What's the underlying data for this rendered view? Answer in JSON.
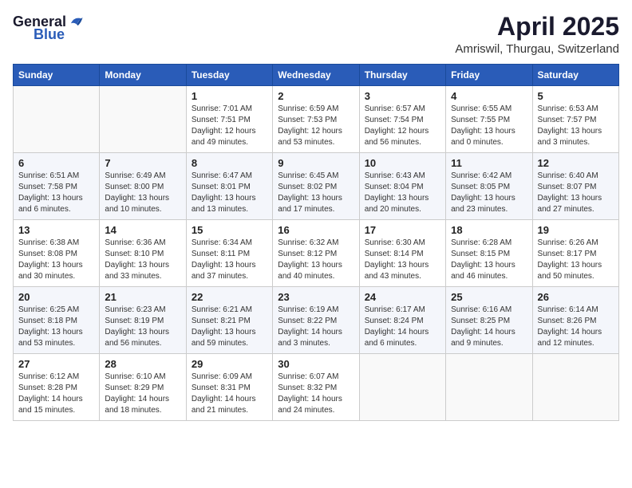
{
  "logo": {
    "general": "General",
    "blue": "Blue"
  },
  "title": "April 2025",
  "location": "Amriswil, Thurgau, Switzerland",
  "columns": [
    "Sunday",
    "Monday",
    "Tuesday",
    "Wednesday",
    "Thursday",
    "Friday",
    "Saturday"
  ],
  "weeks": [
    [
      {
        "day": "",
        "info": ""
      },
      {
        "day": "",
        "info": ""
      },
      {
        "day": "1",
        "info": "Sunrise: 7:01 AM\nSunset: 7:51 PM\nDaylight: 12 hours and 49 minutes."
      },
      {
        "day": "2",
        "info": "Sunrise: 6:59 AM\nSunset: 7:53 PM\nDaylight: 12 hours and 53 minutes."
      },
      {
        "day": "3",
        "info": "Sunrise: 6:57 AM\nSunset: 7:54 PM\nDaylight: 12 hours and 56 minutes."
      },
      {
        "day": "4",
        "info": "Sunrise: 6:55 AM\nSunset: 7:55 PM\nDaylight: 13 hours and 0 minutes."
      },
      {
        "day": "5",
        "info": "Sunrise: 6:53 AM\nSunset: 7:57 PM\nDaylight: 13 hours and 3 minutes."
      }
    ],
    [
      {
        "day": "6",
        "info": "Sunrise: 6:51 AM\nSunset: 7:58 PM\nDaylight: 13 hours and 6 minutes."
      },
      {
        "day": "7",
        "info": "Sunrise: 6:49 AM\nSunset: 8:00 PM\nDaylight: 13 hours and 10 minutes."
      },
      {
        "day": "8",
        "info": "Sunrise: 6:47 AM\nSunset: 8:01 PM\nDaylight: 13 hours and 13 minutes."
      },
      {
        "day": "9",
        "info": "Sunrise: 6:45 AM\nSunset: 8:02 PM\nDaylight: 13 hours and 17 minutes."
      },
      {
        "day": "10",
        "info": "Sunrise: 6:43 AM\nSunset: 8:04 PM\nDaylight: 13 hours and 20 minutes."
      },
      {
        "day": "11",
        "info": "Sunrise: 6:42 AM\nSunset: 8:05 PM\nDaylight: 13 hours and 23 minutes."
      },
      {
        "day": "12",
        "info": "Sunrise: 6:40 AM\nSunset: 8:07 PM\nDaylight: 13 hours and 27 minutes."
      }
    ],
    [
      {
        "day": "13",
        "info": "Sunrise: 6:38 AM\nSunset: 8:08 PM\nDaylight: 13 hours and 30 minutes."
      },
      {
        "day": "14",
        "info": "Sunrise: 6:36 AM\nSunset: 8:10 PM\nDaylight: 13 hours and 33 minutes."
      },
      {
        "day": "15",
        "info": "Sunrise: 6:34 AM\nSunset: 8:11 PM\nDaylight: 13 hours and 37 minutes."
      },
      {
        "day": "16",
        "info": "Sunrise: 6:32 AM\nSunset: 8:12 PM\nDaylight: 13 hours and 40 minutes."
      },
      {
        "day": "17",
        "info": "Sunrise: 6:30 AM\nSunset: 8:14 PM\nDaylight: 13 hours and 43 minutes."
      },
      {
        "day": "18",
        "info": "Sunrise: 6:28 AM\nSunset: 8:15 PM\nDaylight: 13 hours and 46 minutes."
      },
      {
        "day": "19",
        "info": "Sunrise: 6:26 AM\nSunset: 8:17 PM\nDaylight: 13 hours and 50 minutes."
      }
    ],
    [
      {
        "day": "20",
        "info": "Sunrise: 6:25 AM\nSunset: 8:18 PM\nDaylight: 13 hours and 53 minutes."
      },
      {
        "day": "21",
        "info": "Sunrise: 6:23 AM\nSunset: 8:19 PM\nDaylight: 13 hours and 56 minutes."
      },
      {
        "day": "22",
        "info": "Sunrise: 6:21 AM\nSunset: 8:21 PM\nDaylight: 13 hours and 59 minutes."
      },
      {
        "day": "23",
        "info": "Sunrise: 6:19 AM\nSunset: 8:22 PM\nDaylight: 14 hours and 3 minutes."
      },
      {
        "day": "24",
        "info": "Sunrise: 6:17 AM\nSunset: 8:24 PM\nDaylight: 14 hours and 6 minutes."
      },
      {
        "day": "25",
        "info": "Sunrise: 6:16 AM\nSunset: 8:25 PM\nDaylight: 14 hours and 9 minutes."
      },
      {
        "day": "26",
        "info": "Sunrise: 6:14 AM\nSunset: 8:26 PM\nDaylight: 14 hours and 12 minutes."
      }
    ],
    [
      {
        "day": "27",
        "info": "Sunrise: 6:12 AM\nSunset: 8:28 PM\nDaylight: 14 hours and 15 minutes."
      },
      {
        "day": "28",
        "info": "Sunrise: 6:10 AM\nSunset: 8:29 PM\nDaylight: 14 hours and 18 minutes."
      },
      {
        "day": "29",
        "info": "Sunrise: 6:09 AM\nSunset: 8:31 PM\nDaylight: 14 hours and 21 minutes."
      },
      {
        "day": "30",
        "info": "Sunrise: 6:07 AM\nSunset: 8:32 PM\nDaylight: 14 hours and 24 minutes."
      },
      {
        "day": "",
        "info": ""
      },
      {
        "day": "",
        "info": ""
      },
      {
        "day": "",
        "info": ""
      }
    ]
  ]
}
